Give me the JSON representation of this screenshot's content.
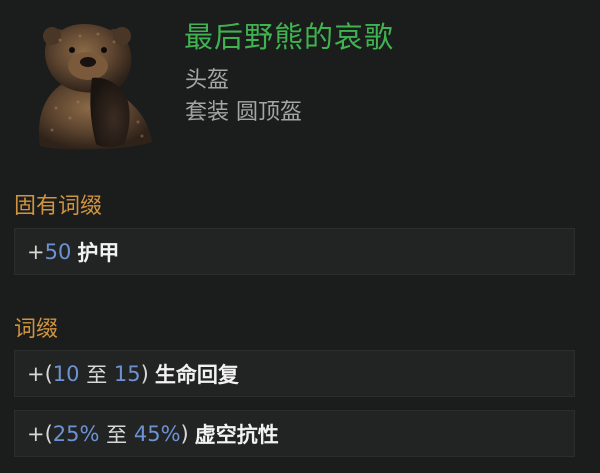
{
  "item": {
    "name": "最后野熊的哀歌",
    "type": "头盔",
    "set_line": "套装 圆顶盔",
    "icon": "bear-head-helmet-icon"
  },
  "colors": {
    "name": "#3fb34f",
    "section": "#d0933f",
    "number": "#6d92d3",
    "secondary_text": "#a4a6a6"
  },
  "implicit": {
    "title": "固有词缀",
    "affixes": [
      {
        "prefix": "+",
        "value": "50",
        "stat": "护甲"
      }
    ]
  },
  "explicit": {
    "title": "词缀",
    "affixes": [
      {
        "prefix": "+(",
        "min": "10",
        "sep": "至",
        "max": "15",
        "suffix": ")",
        "stat": "生命回复"
      },
      {
        "prefix": "+(",
        "min": "25%",
        "sep": "至",
        "max": "45%",
        "suffix": ")",
        "stat": "虚空抗性"
      }
    ]
  }
}
